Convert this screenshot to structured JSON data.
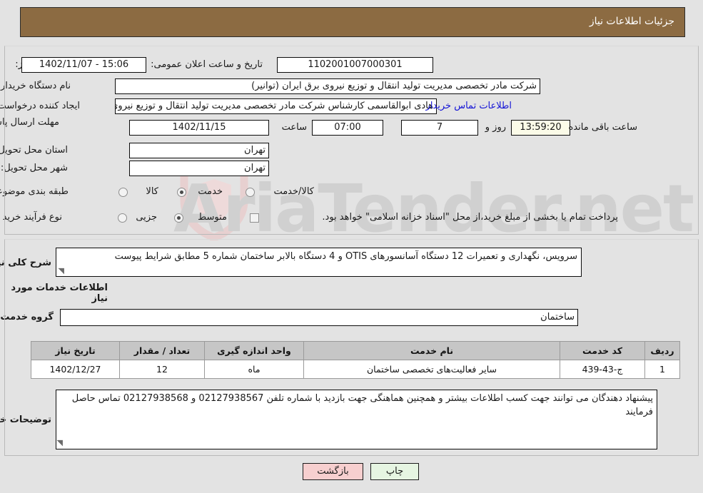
{
  "header": {
    "title": "جزئیات اطلاعات نیاز"
  },
  "colors": {
    "header_bar": "#8c6b42",
    "page_bg": "#e3e3e3",
    "link": "#1414d6",
    "countdown_bg": "#fbfbe8",
    "back_button": "#f7cfcf",
    "print_button": "#e6f5e2",
    "table_header": "#c6c6c6"
  },
  "form": {
    "need_number_label": "شماره نیاز:",
    "need_number_value": "1102001007000301",
    "announce_datetime_label": "تاریخ و ساعت اعلان عمومی:",
    "announce_datetime_value": "15:06 - 1402/11/07",
    "buyer_org_label": "نام دستگاه خریدار:",
    "buyer_org_value": "شرکت مادر تخصصی مدیریت تولید  انتقال و توزیع نیروی برق ایران (توانیر)",
    "requester_label": "ایجاد کننده درخواست:",
    "requester_value": "هادی ابوالقاسمی کارشناس شرکت مادر تخصصی مدیریت تولید  انتقال و توزیع نیروی برق ایران (توانیر)",
    "buyer_contact_link": "اطلاعات تماس خریدار",
    "deadline_label": "مهلت ارسال پاسخ: تا تاریخ:",
    "deadline_date": "1402/11/15",
    "hour_label": "ساعت",
    "deadline_hour": "07:00",
    "days_remaining": "7",
    "days_and_label": "روز و",
    "countdown": "13:59:20",
    "remaining_label": "ساعت باقی مانده",
    "province_label": "استان محل تحویل:",
    "province_value": "تهران",
    "city_label": "شهر محل تحویل:",
    "city_value": "تهران",
    "category_label": "طبقه بندی موضوعی:",
    "category_options": [
      {
        "label": "کالا",
        "selected": false
      },
      {
        "label": "خدمت",
        "selected": true
      },
      {
        "label": "کالا/خدمت",
        "selected": false
      }
    ],
    "process_label": "نوع فرآیند خرید :",
    "process_options": [
      {
        "label": "جزیی",
        "selected": false
      },
      {
        "label": "متوسط",
        "selected": true
      }
    ],
    "treasury_checkbox_label": "پرداخت تمام یا بخشی از مبلغ خرید،از محل \"اسناد خزانه اسلامی\" خواهد بود.",
    "treasury_checked": false
  },
  "description": {
    "label": "شرح کلی نیاز:",
    "value": "سرویس، نگهداری و تعمیرات 12 دستگاه آسانسورهای OTIS و 4 دستگاه بالابر ساختمان شماره 5 مطابق شرایط پیوست"
  },
  "services_section": {
    "heading": "اطلاعات خدمات مورد نیاز",
    "group_label": "گروه خدمت:",
    "group_value": "ساختمان"
  },
  "table": {
    "columns": [
      "ردیف",
      "کد خدمت",
      "نام خدمت",
      "واحد اندازه گیری",
      "تعداد / مقدار",
      "تاریخ نیاز"
    ],
    "rows": [
      {
        "row_no": "1",
        "service_code": "ج-43-439",
        "service_name": "سایر فعالیت‌های تخصصی ساختمان",
        "unit": "ماه",
        "quantity": "12",
        "need_date": "1402/12/27"
      }
    ]
  },
  "buyer_notes": {
    "label": "توضیحات خریدار:",
    "value": "پیشنهاد دهندگان می توانند جهت کسب اطلاعات بیشتر و همچنین هماهنگی جهت بازدید با شماره تلفن 02127938567 و 02127938568 تماس حاصل فرمایند"
  },
  "buttons": {
    "back": "بازگشت",
    "print": "چاپ"
  },
  "watermark": {
    "text": "AriaTender.net"
  }
}
